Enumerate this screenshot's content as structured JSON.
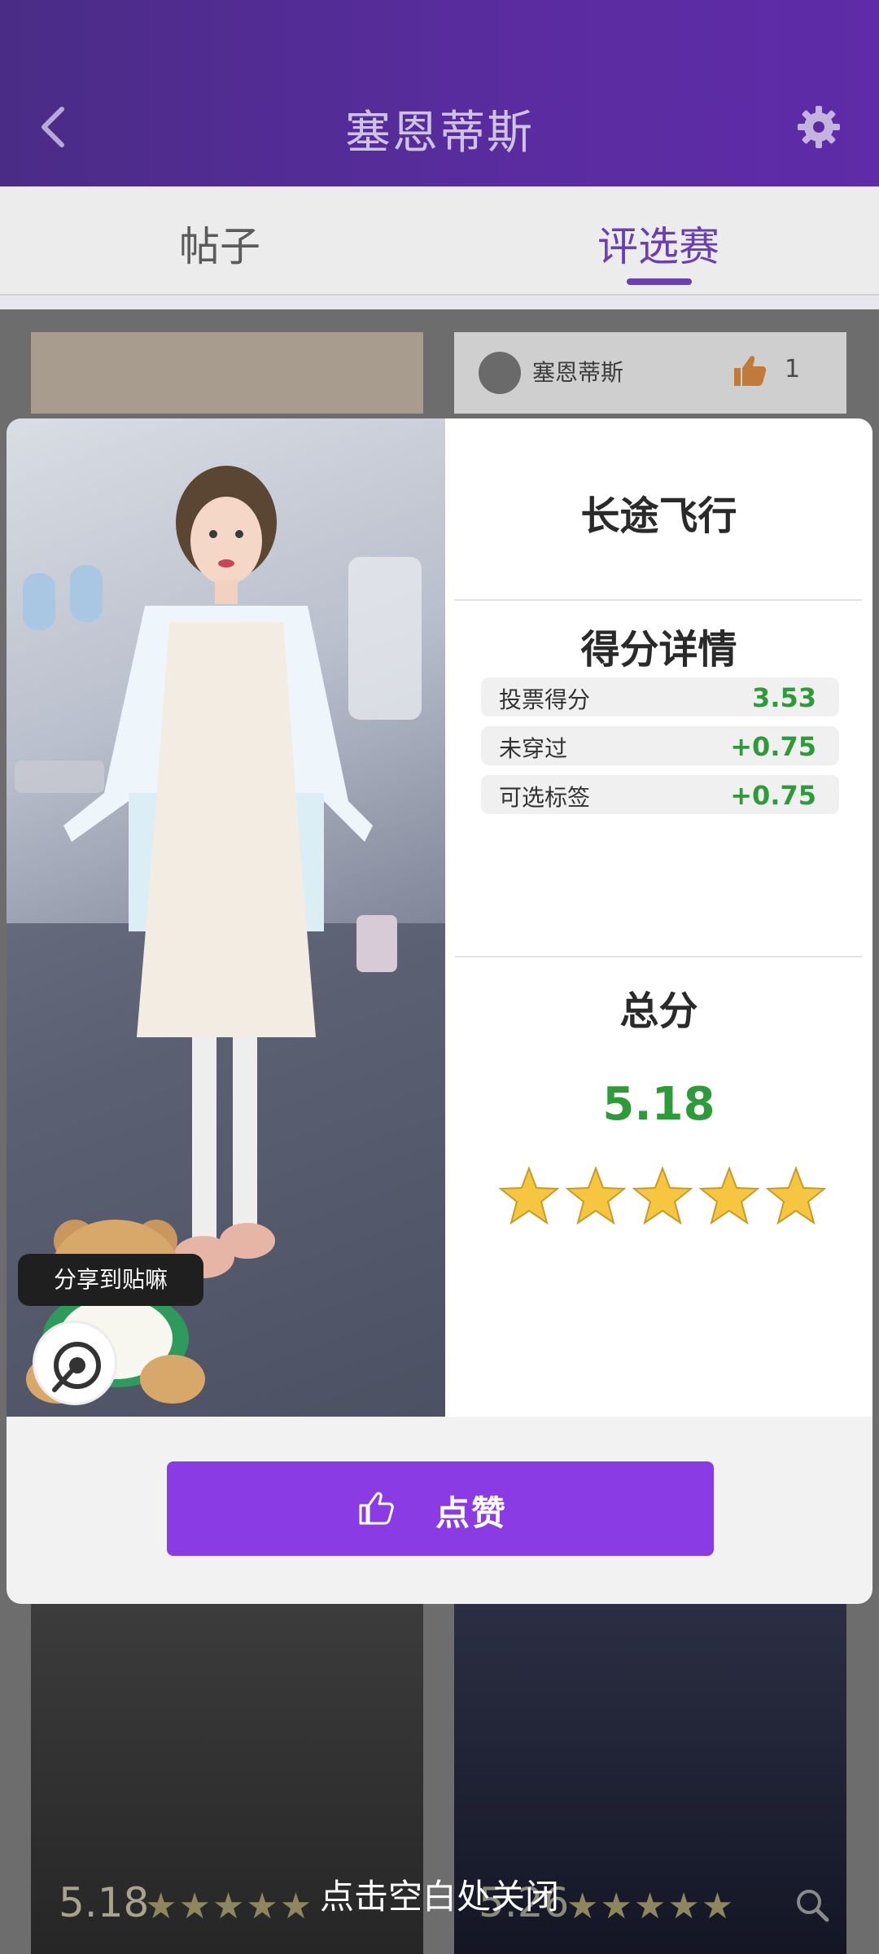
{
  "header": {
    "title": "塞恩蒂斯"
  },
  "tabs": [
    {
      "label": "帖子"
    },
    {
      "label": "评选赛"
    }
  ],
  "background_card": {
    "username": "塞恩蒂斯",
    "like_count": "1"
  },
  "background_scores": {
    "left_score": "5.18",
    "right_score": "5.26"
  },
  "modal": {
    "look_title": "长途飞行",
    "detail_title": "得分详情",
    "rows": [
      {
        "label": "投票得分",
        "value": "3.53"
      },
      {
        "label": "未穿过",
        "value": "+0.75"
      },
      {
        "label": "可选标签",
        "value": "+0.75"
      }
    ],
    "total_title": "总分",
    "total_score": "5.18",
    "stars": 5,
    "share_label": "分享到贴嘛",
    "like_label": "点赞"
  },
  "close_hint": "点击空白处关闭",
  "colors": {
    "header_purple": "#5a2ca0",
    "accent_purple": "#8a3be3",
    "score_green": "#2f9a3a",
    "star_yellow": "#f6c640"
  },
  "icons": [
    "back-arrow-icon",
    "gear-icon",
    "thumbs-up-icon",
    "share-icon",
    "star-icon",
    "magnifier-icon"
  ]
}
